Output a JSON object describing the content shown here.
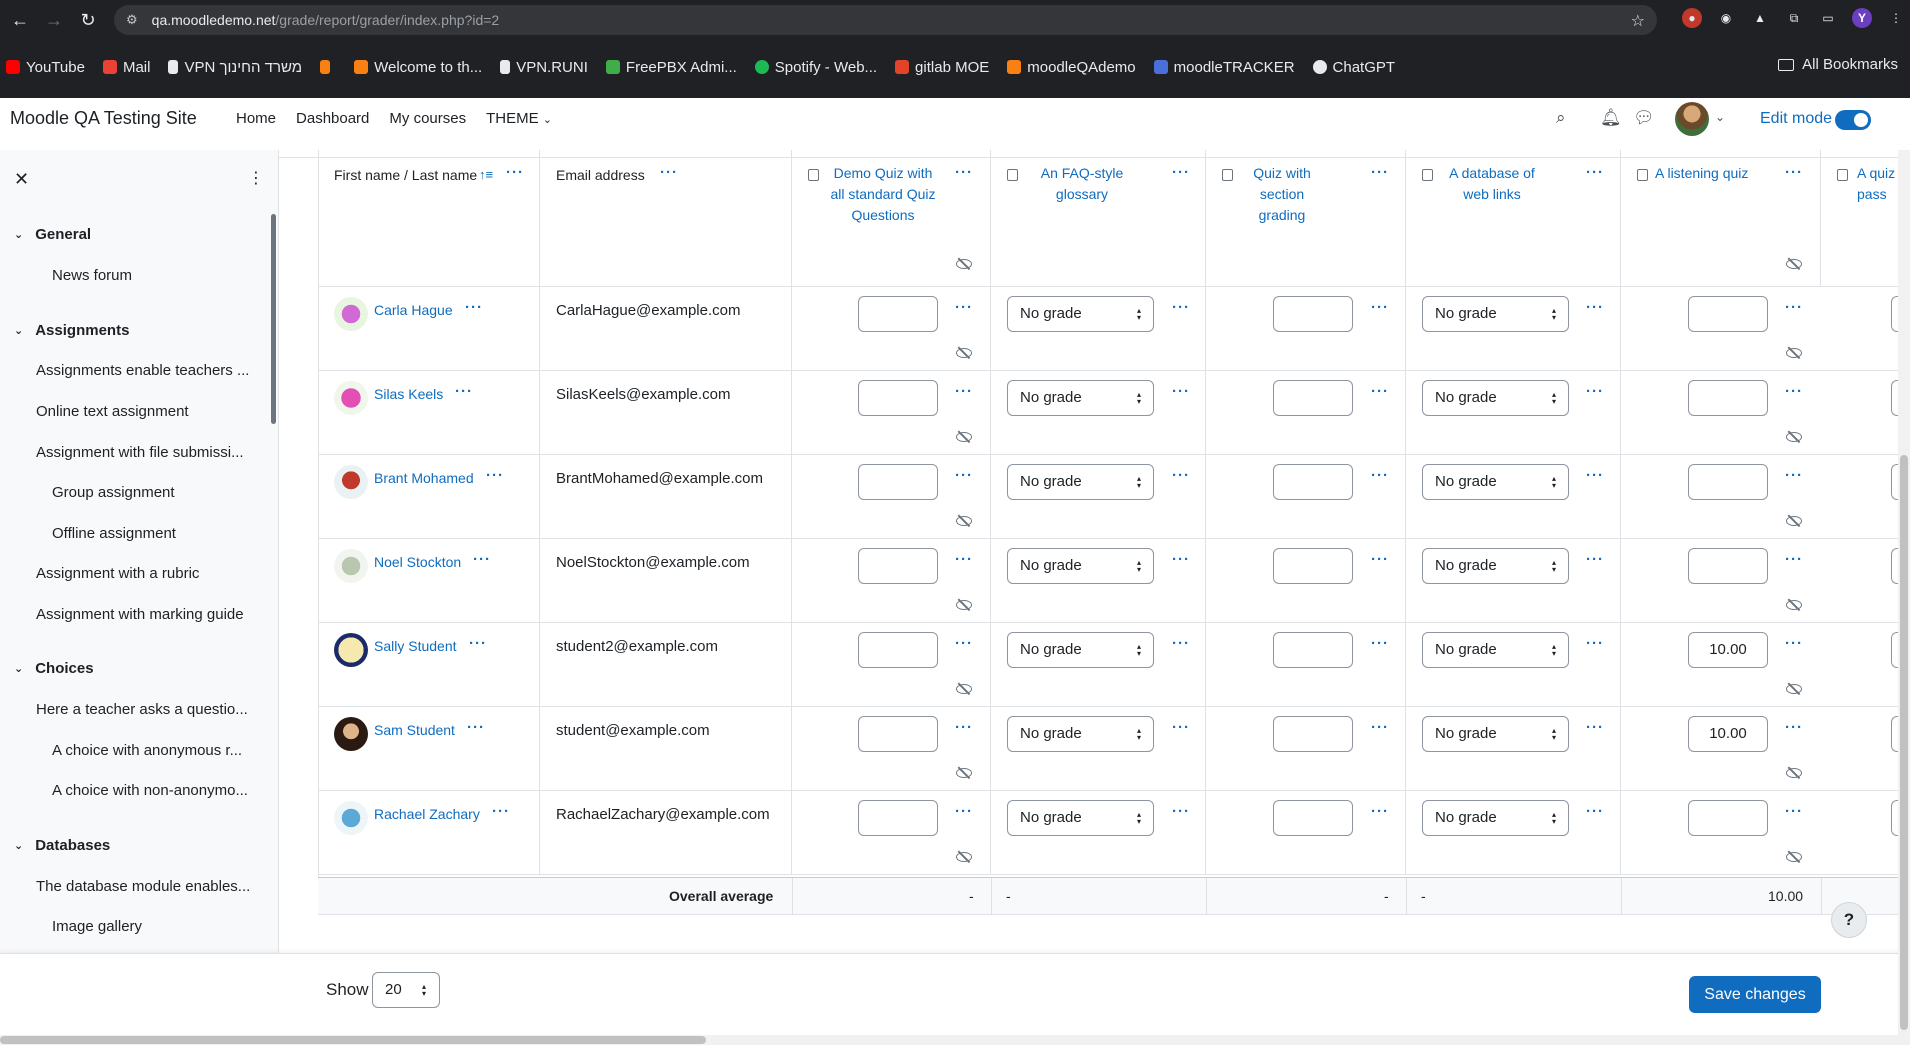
{
  "browser": {
    "url_host": "qa.moodledemo.net",
    "url_path": "/grade/report/grader/index.php?id=2",
    "profile_letter": "Y",
    "bookmarks": [
      "YouTube",
      "Mail",
      "VPN משרד החינוך",
      "Welcome to th...",
      "VPN.RUNI",
      "FreePBX Admi...",
      "Spotify - Web...",
      "gitlab MOE",
      "moodleQAdemo",
      "moodleTRACKER",
      "ChatGPT"
    ],
    "all_bookmarks": "All Bookmarks"
  },
  "navbar": {
    "site_name": "Moodle QA Testing Site",
    "links": [
      "Home",
      "Dashboard",
      "My courses",
      "THEME"
    ],
    "edit_mode": "Edit mode"
  },
  "drawer": {
    "sections": [
      {
        "title": "General",
        "items": [
          "News forum"
        ]
      },
      {
        "title": "Assignments",
        "items": [
          "Assignments enable teachers ...",
          "Online text assignment",
          "Assignment with file submissi...",
          "Group assignment",
          "Offline assignment",
          "Assignment with a rubric",
          "Assignment with marking guide"
        ]
      },
      {
        "title": "Choices",
        "items": [
          "Here a teacher asks a questio...",
          "A choice with anonymous r...",
          "A choice with non-anonymo..."
        ]
      },
      {
        "title": "Databases",
        "items": [
          "The database module enables...",
          "Image gallery"
        ]
      }
    ]
  },
  "grader": {
    "columns": {
      "name": "First name / Last name",
      "email": "Email address",
      "items": [
        "Demo Quiz with all standard Quiz Questions",
        "An FAQ-style glossary",
        "Quiz with section grading",
        "A database of web links",
        "A listening quiz",
        "A quiz pass"
      ]
    },
    "no_grade": "No grade",
    "students": [
      {
        "name": "Carla Hague",
        "email": "CarlaHague@example.com",
        "listening": ""
      },
      {
        "name": "Silas Keels",
        "email": "SilasKeels@example.com",
        "listening": ""
      },
      {
        "name": "Brant Mohamed",
        "email": "BrantMohamed@example.com",
        "listening": ""
      },
      {
        "name": "Noel Stockton",
        "email": "NoelStockton@example.com",
        "listening": ""
      },
      {
        "name": "Sally Student",
        "email": "student2@example.com",
        "listening": "10.00"
      },
      {
        "name": "Sam Student",
        "email": "student@example.com",
        "listening": "10.00"
      },
      {
        "name": "Rachael Zachary",
        "email": "RachaelZachary@example.com",
        "listening": ""
      }
    ],
    "overall_average": {
      "label": "Overall average",
      "demo_quiz": "-",
      "faq_glossary": "-",
      "section_quiz": "-",
      "database": "-",
      "listening_quiz": "10.00"
    }
  },
  "footer": {
    "show_label": "Show",
    "show_value": "20",
    "save_label": "Save changes",
    "help": "?"
  },
  "colors": {
    "primary": "#0f6cbf",
    "browser_chrome": "#202124"
  }
}
